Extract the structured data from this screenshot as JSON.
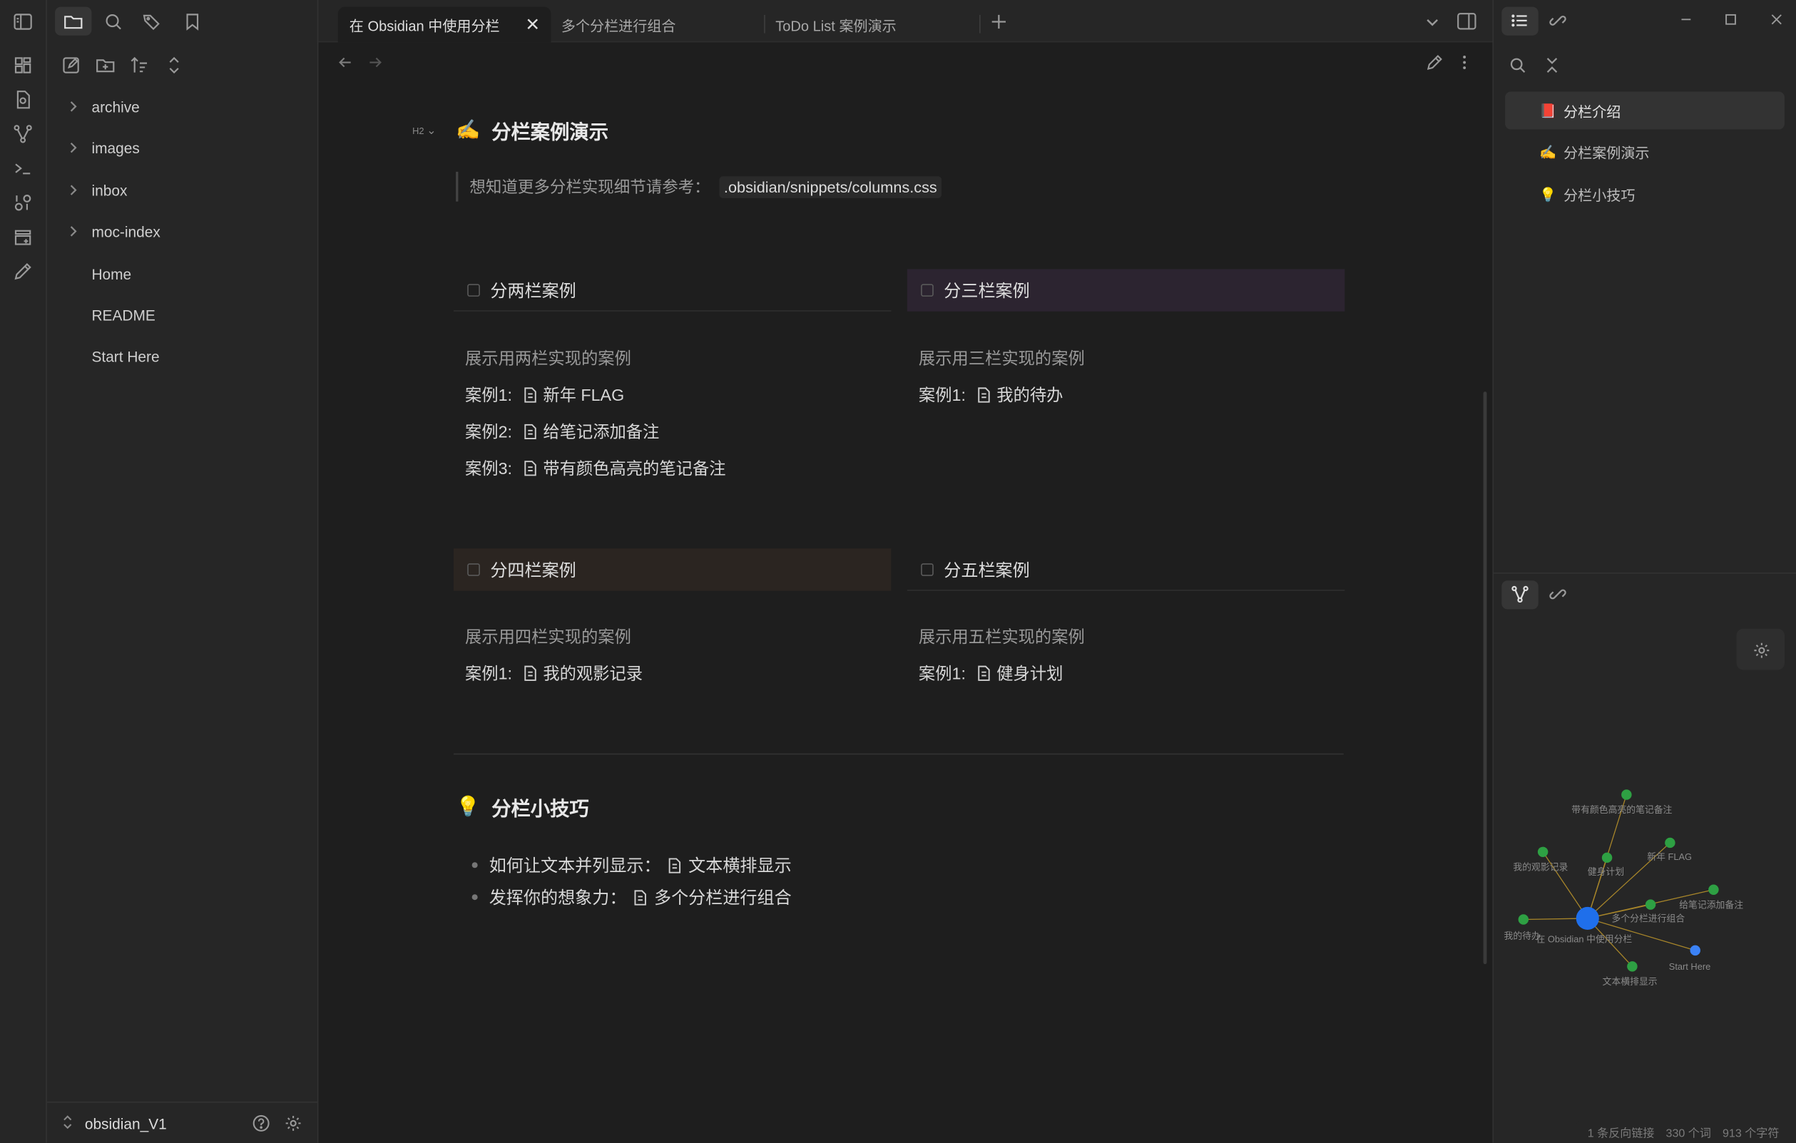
{
  "sidebar_left": {
    "tree": [
      {
        "label": "archive",
        "folder": true
      },
      {
        "label": "images",
        "folder": true
      },
      {
        "label": "inbox",
        "folder": true
      },
      {
        "label": "moc-index",
        "folder": true
      },
      {
        "label": "Home",
        "folder": false
      },
      {
        "label": "README",
        "folder": false
      },
      {
        "label": "Start Here",
        "folder": false
      }
    ],
    "vault_name": "obsidian_V1"
  },
  "tabs": [
    {
      "label": "在 Obsidian 中使用分栏",
      "active": true
    },
    {
      "label": "多个分栏进行组合",
      "active": false
    },
    {
      "label": "ToDo List 案例演示",
      "active": false
    }
  ],
  "note": {
    "heading_badge": "H2",
    "section1": {
      "emoji": "✍️",
      "title": "分栏案例演示"
    },
    "callout_text": "想知道更多分栏实现细节请参考：",
    "callout_code": ".obsidian/snippets/columns.css",
    "columns": [
      {
        "title": "分两栏案例",
        "desc": "展示用两栏实现的案例",
        "highlight": "",
        "cases": [
          {
            "prefix": "案例1:",
            "link": "新年 FLAG"
          },
          {
            "prefix": "案例2:",
            "link": "给笔记添加备注"
          },
          {
            "prefix": "案例3:",
            "link": "带有颜色高亮的笔记备注"
          }
        ]
      },
      {
        "title": "分三栏案例",
        "desc": "展示用三栏实现的案例",
        "highlight": "#2c2430",
        "cases": [
          {
            "prefix": "案例1:",
            "link": "我的待办"
          }
        ]
      },
      {
        "title": "分四栏案例",
        "desc": "展示用四栏实现的案例",
        "highlight": "#2b2521",
        "cases": [
          {
            "prefix": "案例1:",
            "link": "我的观影记录"
          }
        ]
      },
      {
        "title": "分五栏案例",
        "desc": "展示用五栏实现的案例",
        "highlight": "",
        "cases": [
          {
            "prefix": "案例1:",
            "link": "健身计划"
          }
        ]
      }
    ],
    "section2": {
      "emoji": "💡",
      "title": "分栏小技巧"
    },
    "bullets": [
      {
        "prefix": "如何让文本并列显示：",
        "link": "文本横排显示"
      },
      {
        "prefix": "发挥你的想象力：",
        "link": "多个分栏进行组合"
      }
    ]
  },
  "outline": [
    {
      "emoji": "📕",
      "label": "分栏介绍",
      "active": true
    },
    {
      "emoji": "✍️",
      "label": "分栏案例演示",
      "active": false
    },
    {
      "emoji": "💡",
      "label": "分栏小技巧",
      "active": false
    }
  ],
  "graph": {
    "center_label": "在 Obsidian 中使用分栏",
    "nodes": [
      {
        "label": "带有颜色高亮的笔记备注",
        "color": "green"
      },
      {
        "label": "新年 FLAG",
        "color": "green"
      },
      {
        "label": "我的观影记录",
        "color": "green"
      },
      {
        "label": "健身计划",
        "color": "green"
      },
      {
        "label": "给笔记添加备注",
        "color": "green"
      },
      {
        "label": "多个分栏进行组合",
        "color": "green"
      },
      {
        "label": "我的待办",
        "color": "green"
      },
      {
        "label": "Start Here",
        "color": "blue"
      },
      {
        "label": "文本横排显示",
        "color": "green"
      }
    ]
  },
  "status": {
    "backlinks": "1 条反向链接",
    "words": "330 个词",
    "chars": "913 个字符"
  },
  "colors": {
    "accent": "#3b82f6",
    "graph_green": "#2ea043",
    "graph_center": "#1f6feb"
  }
}
